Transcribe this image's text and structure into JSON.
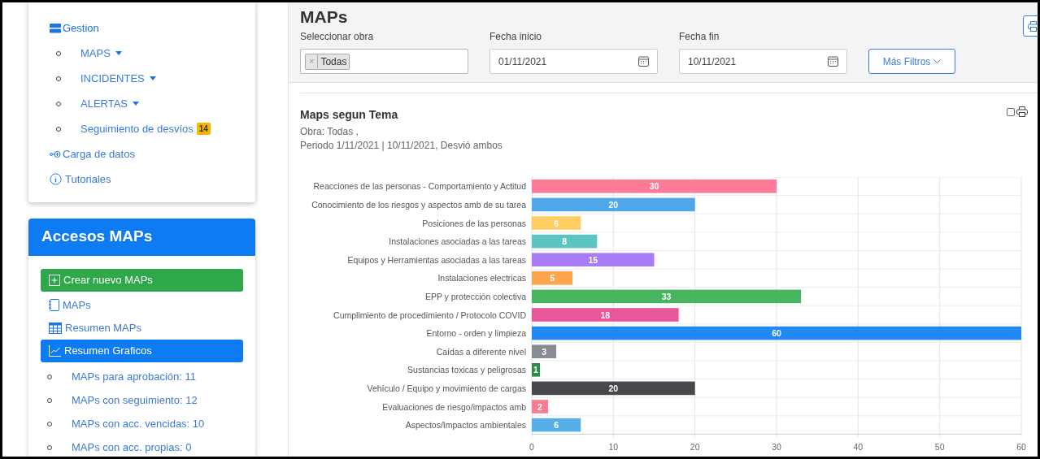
{
  "sidebar": {
    "menu": {
      "title": "Gestion",
      "items": [
        {
          "label": "MAPS",
          "dropdown": true
        },
        {
          "label": "INCIDENTES",
          "dropdown": true
        },
        {
          "label": "ALERTAS",
          "dropdown": true
        },
        {
          "label": "Seguimiento de desvíos",
          "dropdown": false,
          "badge": "14"
        }
      ],
      "links": [
        "Carga de datos",
        "Tutoriales"
      ]
    },
    "accesos": {
      "title": "Accesos MAPs",
      "actions": [
        {
          "label": "Crear nuevo MAPs",
          "kind": "create",
          "selected": false
        },
        {
          "label": "MAPs",
          "kind": "link",
          "selected": false
        },
        {
          "label": "Resumen MAPs",
          "kind": "link",
          "selected": false
        },
        {
          "label": "Resumen Graficos",
          "kind": "link",
          "selected": true
        }
      ],
      "stats": [
        "MAPs para aprobación: 11",
        "MAPs con seguimiento: 12",
        "MAPs con acc. vencidas: 10",
        "MAPs con acc. propias: 0"
      ]
    }
  },
  "header": {
    "title": "MAPs",
    "obra": {
      "label": "Seleccionar obra",
      "tags": [
        {
          "remove": "×",
          "label": "Todas"
        }
      ]
    },
    "fecha_inicio": {
      "label": "Fecha inicio",
      "value": "01/11/2021"
    },
    "fecha_fin": {
      "label": "Fecha fin",
      "value": "10/11/2021"
    },
    "more_button": "Más Filtros"
  },
  "panel": {
    "title": "Maps segun Tema",
    "subtitle_lines": [
      "Obra: Todas ,",
      "Periodo 1/11/2021 | 10/11/2021, Desvió ambos"
    ],
    "checked": false,
    "chart_data": {
      "type": "bar",
      "orientation": "horizontal",
      "categories": [
        "Reacciones de las personas - Comportamiento y Actitud",
        "Conocimiento de los riesgos y aspectos amb de su tarea",
        "Posiciones de las personas",
        "Instalaciones asociadas a las tareas",
        "Equipos y Herramientas asociadas a las tareas",
        "Instalaciones electricas",
        "EPP y protección colectiva",
        "Cumplimiento de procedimiento / Protocolo COVID",
        "Entorno - orden y limpieza",
        "Caídas a diferente nivel",
        "Sustancias toxicas y peligrosas",
        "Vehículo / Equipo y movimiento de cargas",
        "Evaluaciones de riesgo/impactos amb",
        "Aspectos/Impactos ambientales"
      ],
      "series": [
        {
          "values": [
            30,
            20,
            6,
            8,
            15,
            5,
            33,
            18,
            60,
            3,
            1,
            20,
            2,
            6
          ]
        }
      ],
      "xlim": [
        0,
        60
      ],
      "xticks": [
        0,
        10,
        20,
        30,
        40,
        50,
        60
      ],
      "grid": true,
      "data_labels": true
    }
  }
}
